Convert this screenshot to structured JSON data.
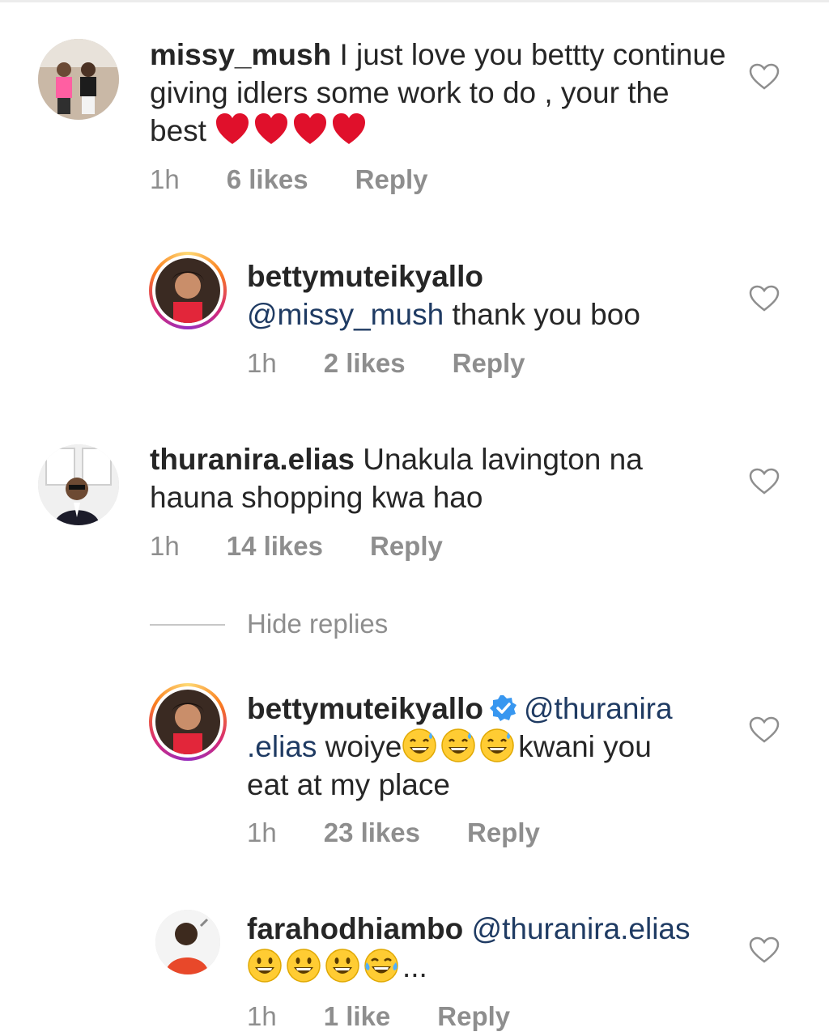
{
  "comments": [
    {
      "username": "missy_mush",
      "text": "I just love you bettty continue giving idlers some work to do , your the best",
      "time": "1h",
      "likes": "6 likes",
      "reply": "Reply"
    },
    {
      "username": "bettymuteikyallo",
      "mention": "@missy_mush",
      "text": "thank you boo",
      "time": "1h",
      "likes": "2 likes",
      "reply": "Reply"
    },
    {
      "username": "thuranira.elias",
      "text": "Unakula lavington na hauna shopping kwa hao",
      "time": "1h",
      "likes": "14 likes",
      "reply": "Reply"
    },
    {
      "username": "bettymuteikyallo",
      "mention_part1": "@thuranira",
      "mention_part2": ".elias",
      "text_a": "woiye",
      "text_b": "kwani you",
      "text_c": "eat at my place",
      "time": "1h",
      "likes": "23 likes",
      "reply": "Reply"
    },
    {
      "username": "farahodhiambo",
      "mention": "@thuranira.elias",
      "text": "...",
      "time": "1h",
      "likes": "1 like",
      "reply": "Reply"
    }
  ],
  "hide_replies_label": "Hide replies",
  "colors": {
    "text": "#262626",
    "meta": "#8e8e8e",
    "mention": "#1f3b63",
    "heart_emoji": "#e0245e",
    "verified": "#3897f0"
  },
  "icons": [
    "heart-outline-icon",
    "red-heart-emoji",
    "sweat-smile-emoji",
    "grin-emoji",
    "tears-of-joy-emoji",
    "verified-badge-icon"
  ]
}
